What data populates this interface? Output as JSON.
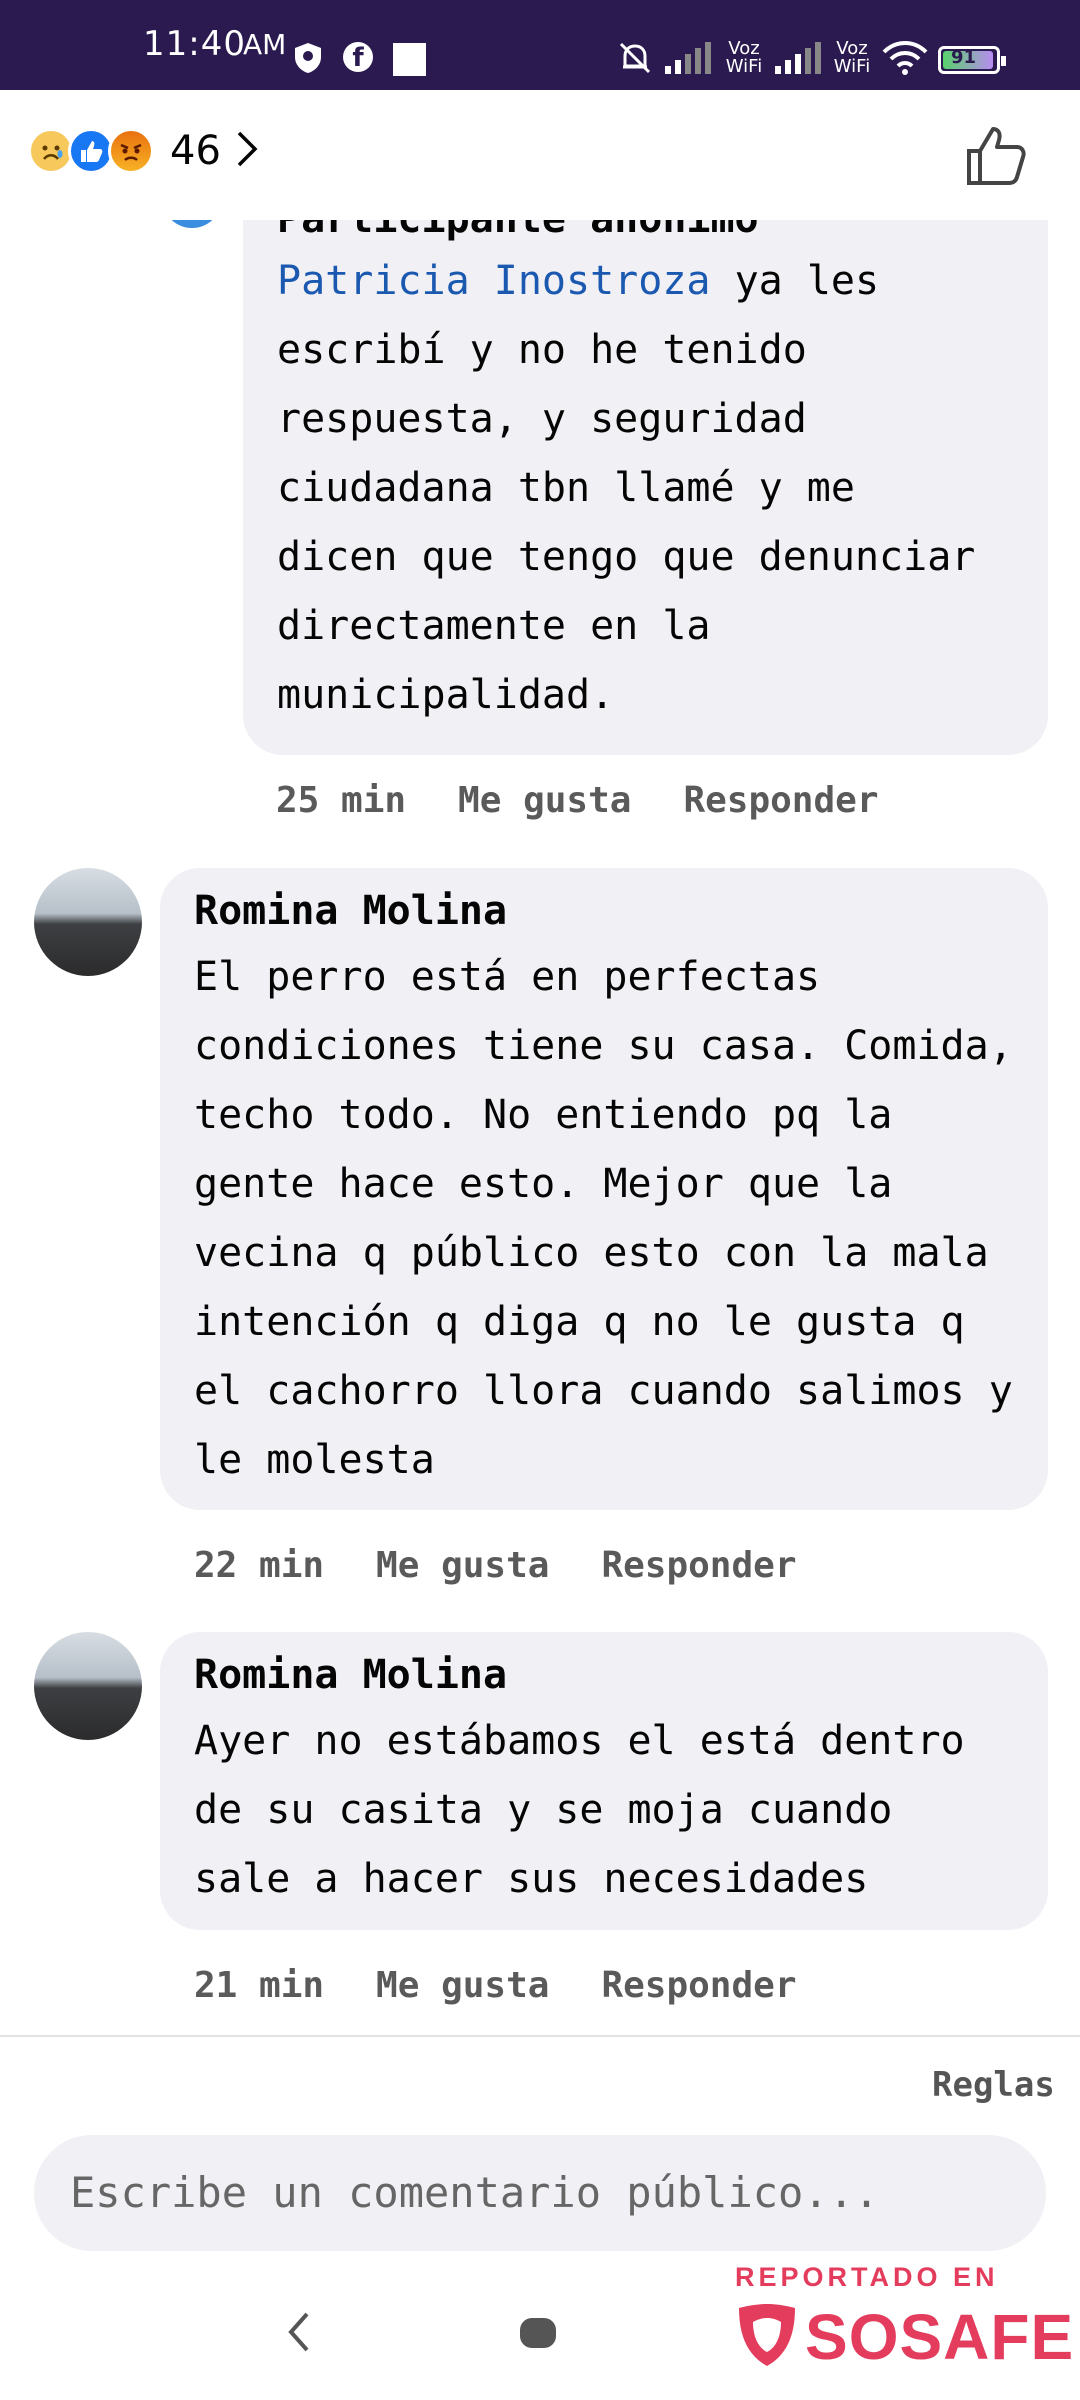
{
  "status_bar": {
    "time": "11:40",
    "ampm": "AM",
    "fb_glyph": "f",
    "voz_wifi_1": "Voz WiFi",
    "voz_wifi_2": "Voz WiFi",
    "battery": "91"
  },
  "top_bar": {
    "reaction_count": "46",
    "reaction_icons": [
      "sad-face-icon",
      "like-icon",
      "angry-face-icon"
    ]
  },
  "comments": [
    {
      "author": "Participante anónimo",
      "mention": "Patricia Inostroza",
      "lines": [
        " ya les",
        "escribí y no he tenido",
        "respuesta, y seguridad",
        "ciudadana tbn llamé y me",
        "dicen que tengo que denunciar",
        "directamente en la",
        "municipalidad."
      ],
      "time": "25 min",
      "like": "Me gusta",
      "reply": "Responder"
    },
    {
      "author": "Romina Molina",
      "lines": [
        "El perro está en perfectas",
        "condiciones tiene su casa. Comida,",
        "techo todo. No entiendo pq la",
        "gente hace esto. Mejor que la",
        "vecina q público esto con la mala",
        "intención q diga q no le gusta q",
        "el cachorro llora cuando salimos y",
        "le molesta"
      ],
      "time": "22 min",
      "like": "Me gusta",
      "reply": "Responder"
    },
    {
      "author": "Romina Molina",
      "lines": [
        "Ayer no estábamos el está dentro",
        "de su casita y se moja cuando",
        "sale a hacer sus necesidades"
      ],
      "time": "21 min",
      "like": "Me gusta",
      "reply": "Responder"
    }
  ],
  "footer": {
    "rules": "Reglas",
    "composer_placeholder": "Escribe un comentario público..."
  },
  "watermark": {
    "top": "REPORTADO EN",
    "brand": "SOSAFE"
  },
  "colors": {
    "status_bar_bg": "#2b1a4f",
    "bubble_bg": "#f0f0f5",
    "mention": "#1b59b0",
    "watermark": "#e43c5c"
  }
}
